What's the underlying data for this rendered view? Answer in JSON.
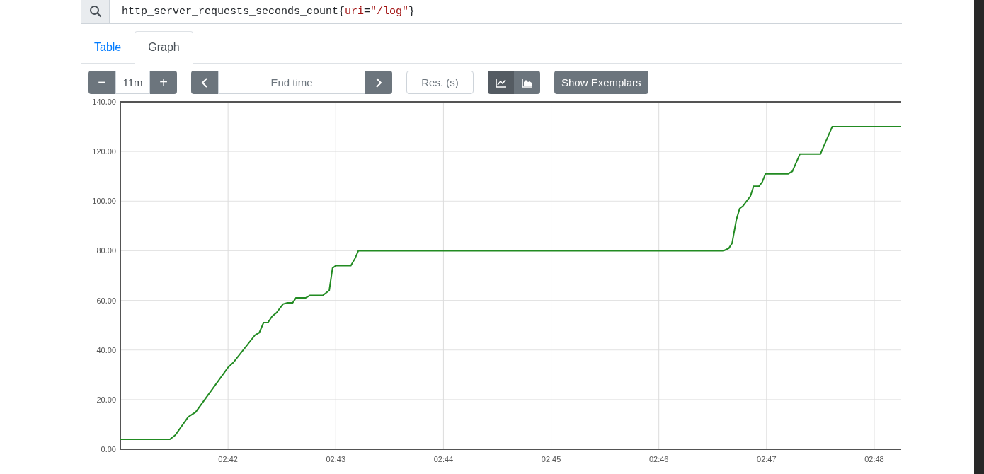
{
  "query": {
    "segments": [
      {
        "kind": "plain",
        "text": "http_server_requests_seconds_count{"
      },
      {
        "kind": "label",
        "text": "uri"
      },
      {
        "kind": "plain",
        "text": "="
      },
      {
        "kind": "label",
        "text": "\"/log\""
      },
      {
        "kind": "plain",
        "text": "}"
      }
    ]
  },
  "tabs": [
    {
      "label": "Table",
      "selected": false
    },
    {
      "label": "Graph",
      "selected": true
    }
  ],
  "toolbar": {
    "range_decrease": "−",
    "range": "11m",
    "range_increase": "+",
    "end_time": {
      "placeholder": "End time"
    },
    "resolution": {
      "placeholder": "Res. (s)"
    },
    "chart_types": [
      {
        "kind": "line",
        "selected": true
      },
      {
        "kind": "stacked",
        "selected": false
      }
    ],
    "exemplars_button": "Show Exemplars"
  },
  "graph": {
    "chart_data": {
      "type": "line",
      "grid": true,
      "ylim": [
        0,
        140
      ],
      "xlim": [
        161,
        168.25
      ],
      "yticks": [
        {
          "value": 0,
          "label": "0.00"
        },
        {
          "value": 20,
          "label": "20.00"
        },
        {
          "value": 40,
          "label": "40.00"
        },
        {
          "value": 60,
          "label": "60.00"
        },
        {
          "value": 80,
          "label": "80.00"
        },
        {
          "value": 100,
          "label": "100.00"
        },
        {
          "value": 120,
          "label": "120.00"
        },
        {
          "value": 140,
          "label": "140.00"
        }
      ],
      "xticks": [
        {
          "value": 162,
          "label": "02:42"
        },
        {
          "value": 163,
          "label": "02:43"
        },
        {
          "value": 164,
          "label": "02:44"
        },
        {
          "value": 165,
          "label": "02:45"
        },
        {
          "value": 166,
          "label": "02:46"
        },
        {
          "value": 167,
          "label": "02:47"
        },
        {
          "value": 168,
          "label": "02:48"
        }
      ],
      "x": [
        161,
        161.46,
        161.51,
        161.63,
        161.7,
        162.0,
        162.05,
        162.25,
        162.29,
        162.33,
        162.37,
        162.41,
        162.45,
        162.51,
        162.55,
        162.6,
        162.63,
        162.72,
        162.76,
        162.88,
        162.94,
        162.97,
        163.0,
        163.14,
        163.18,
        163.21,
        166.6,
        166.65,
        166.68,
        166.72,
        166.75,
        166.78,
        166.85,
        166.88,
        166.93,
        166.96,
        166.99,
        167.2,
        167.24,
        167.31,
        167.5,
        167.57,
        167.61,
        168.25
      ],
      "series": [
        {
          "color": "#228b22",
          "values": [
            4,
            4,
            5.7,
            13,
            15,
            33,
            35,
            46,
            47,
            51,
            51,
            53.6,
            55,
            58.5,
            59,
            59,
            61,
            61,
            62,
            62,
            64,
            73,
            74,
            74,
            77,
            80,
            80,
            81,
            83,
            92.5,
            97,
            98,
            102,
            106,
            106,
            107.7,
            111,
            111,
            112,
            119,
            119,
            126,
            130,
            130
          ]
        }
      ]
    }
  }
}
